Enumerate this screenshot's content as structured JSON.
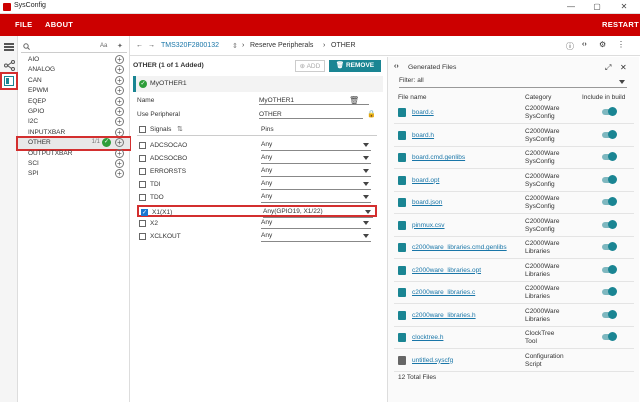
{
  "window": {
    "title": "SysConfig",
    "minimize": "—",
    "maximize": "▢",
    "close": "✕"
  },
  "menubar": {
    "file": "FILE",
    "about": "ABOUT",
    "restart": "RESTART"
  },
  "modules": {
    "search_placeholder": "",
    "items": [
      {
        "label": "AIO"
      },
      {
        "label": "ANALOG"
      },
      {
        "label": "CAN"
      },
      {
        "label": "EPWM"
      },
      {
        "label": "EQEP"
      },
      {
        "label": "GPIO"
      },
      {
        "label": "I2C"
      },
      {
        "label": "INPUTXBAR"
      },
      {
        "label": "OTHER",
        "count": "1/1"
      },
      {
        "label": "OUTPUTXBAR"
      },
      {
        "label": "SCI"
      },
      {
        "label": "SPI"
      }
    ]
  },
  "breadcrumb": {
    "device": "TMS320F2800132",
    "section": "Reserve Peripherals",
    "page": "OTHER"
  },
  "config": {
    "heading": "OTHER (1 of 1 Added)",
    "add_label": "ADD",
    "remove_all_label": "REMOVE ALL",
    "instance_name": "MyOTHER1",
    "name_label": "Name",
    "name_value": "MyOTHER1",
    "use_label": "Use Peripheral",
    "use_value": "OTHER",
    "signals_label": "Signals",
    "pins_label": "Pins",
    "signals": [
      {
        "name": "ADCSOCAO",
        "pin": "Any",
        "checked": false
      },
      {
        "name": "ADCSOCBO",
        "pin": "Any",
        "checked": false
      },
      {
        "name": "ERRORSTS",
        "pin": "Any",
        "checked": false
      },
      {
        "name": "TDI",
        "pin": "Any",
        "checked": false
      },
      {
        "name": "TDO",
        "pin": "Any",
        "checked": false
      },
      {
        "name": "X1(X1)",
        "pin": "Any(GPIO19, X1/22)",
        "checked": true
      },
      {
        "name": "X2",
        "pin": "Any",
        "checked": false
      },
      {
        "name": "XCLKOUT",
        "pin": "Any",
        "checked": false
      }
    ]
  },
  "files": {
    "title": "Generated Files",
    "filter_label": "Filter:",
    "filter_value": "all",
    "col_file": "File name",
    "col_category": "Category",
    "col_include": "Include in build",
    "rows": [
      {
        "name": "board.c",
        "cat1": "C2000Ware",
        "cat2": "SysConfig",
        "toggle": true
      },
      {
        "name": "board.h",
        "cat1": "C2000Ware",
        "cat2": "SysConfig",
        "toggle": true
      },
      {
        "name": "board.cmd.genlibs",
        "cat1": "C2000Ware",
        "cat2": "SysConfig",
        "toggle": true
      },
      {
        "name": "board.opt",
        "cat1": "C2000Ware",
        "cat2": "SysConfig",
        "toggle": true
      },
      {
        "name": "board.json",
        "cat1": "C2000Ware",
        "cat2": "SysConfig",
        "toggle": true
      },
      {
        "name": "pinmux.csv",
        "cat1": "C2000Ware",
        "cat2": "SysConfig",
        "toggle": true
      },
      {
        "name": "c2000ware_libraries.cmd.genlibs",
        "cat1": "C2000Ware",
        "cat2": "Libraries",
        "toggle": true
      },
      {
        "name": "c2000ware_libraries.opt",
        "cat1": "C2000Ware",
        "cat2": "Libraries",
        "toggle": true
      },
      {
        "name": "c2000ware_libraries.c",
        "cat1": "C2000Ware",
        "cat2": "Libraries",
        "toggle": true
      },
      {
        "name": "c2000ware_libraries.h",
        "cat1": "C2000Ware",
        "cat2": "Libraries",
        "toggle": true
      },
      {
        "name": "clocktree.h",
        "cat1": "ClockTree",
        "cat2": "Tool",
        "toggle": true
      },
      {
        "name": "untitled.syscfg",
        "cat1": "Configuration",
        "cat2": "Script",
        "toggle": false
      }
    ],
    "total": "12 Total Files"
  },
  "colors": {
    "brand": "#cc0000",
    "accent": "#1a8593",
    "highlight": "#d32f2f"
  }
}
